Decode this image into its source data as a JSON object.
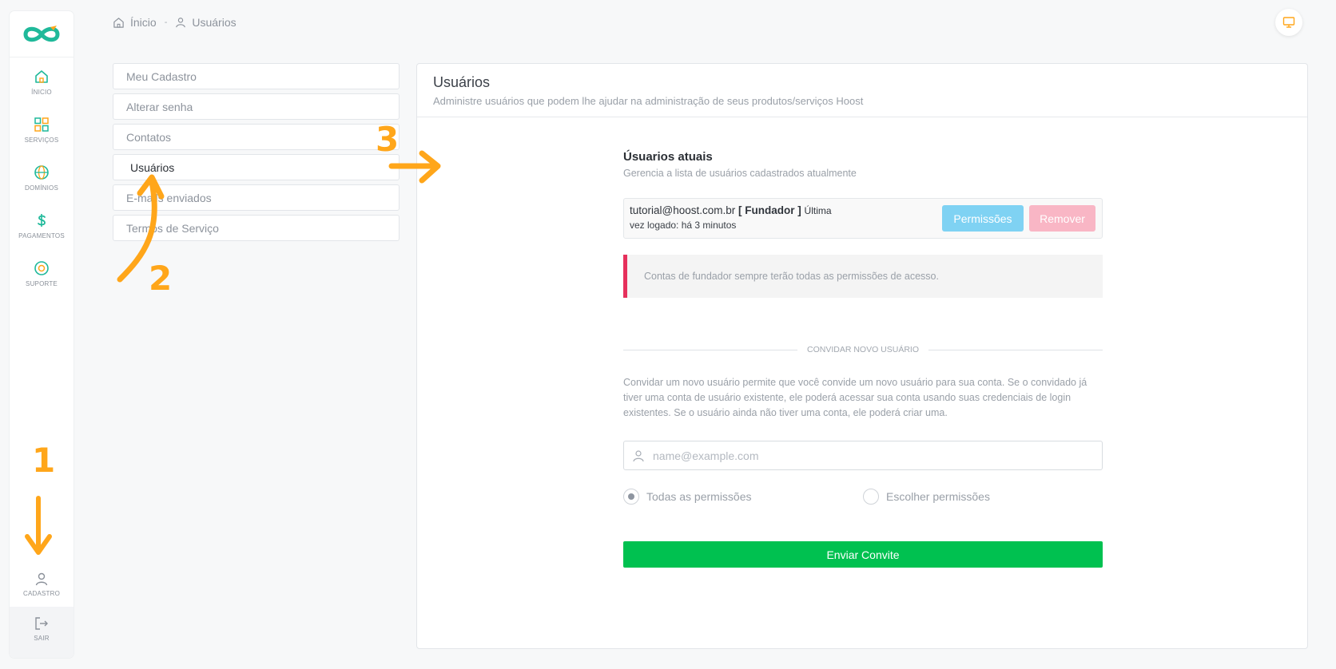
{
  "rail": {
    "items": [
      {
        "label": "ÍNICIO",
        "icon": "home-icon"
      },
      {
        "label": "SERVIÇOS",
        "icon": "services-grid-icon"
      },
      {
        "label": "DOMÍNIOS",
        "icon": "globe-icon"
      },
      {
        "label": "PAGAMENTOS",
        "icon": "dollar-icon"
      },
      {
        "label": "SUPORTE",
        "icon": "lifebuoy-icon"
      }
    ],
    "profile_label": "CADASTRO",
    "exit_label": "SAIR",
    "accent": "#1fb99a"
  },
  "breadcrumb": {
    "home": "Ínicio",
    "separator": "-",
    "current": "Usuários"
  },
  "menu": {
    "items": [
      {
        "label": "Meu Cadastro"
      },
      {
        "label": "Alterar senha"
      },
      {
        "label": "Contatos"
      },
      {
        "label": "Usuários"
      },
      {
        "label": "E-mails enviados"
      },
      {
        "label": "Termos de Serviço"
      }
    ]
  },
  "card": {
    "title": "Usuários",
    "subtitle": "Administre usuários que podem lhe ajudar na administração de seus produtos/serviços Hoost"
  },
  "current_users": {
    "title": "Úsuarios atuais",
    "subtitle": "Gerencia a lista de usuários cadastrados atualmente",
    "user": {
      "email": "tutorial@hoost.com.br",
      "role": "[ Fundador ]",
      "last_prefix": "Última",
      "last_login": "vez logado: há 3 minutos"
    },
    "permissions_button": "Permissões",
    "remove_button": "Remover",
    "notice": "Contas de fundador sempre terão todas as permissões de acesso."
  },
  "invite": {
    "divider": "CONVIDAR NOVO USUÁRIO",
    "text": "Convidar um novo usuário permite que você convide um novo usuário para sua conta. Se o convidado já tiver uma conta de usuário existente, ele poderá acessar sua conta usando suas credenciais de login existentes. Se o usuário ainda não tiver uma conta, ele poderá criar uma.",
    "email_placeholder": "name@example.com",
    "email_value": "",
    "option_all": "Todas as permissões",
    "option_choose": "Escolher permissões",
    "selected_option": "Todas as permissões",
    "send_button": "Enviar Convite"
  },
  "annotations": {
    "step1": "1",
    "step2": "2",
    "step3": "3",
    "color": "#ffa61a"
  },
  "colors": {
    "send_green": "#00c150",
    "permissions_blue": "#7fd2f3",
    "remove_pink": "#f9b6c5",
    "notice_red": "#e6305c"
  }
}
